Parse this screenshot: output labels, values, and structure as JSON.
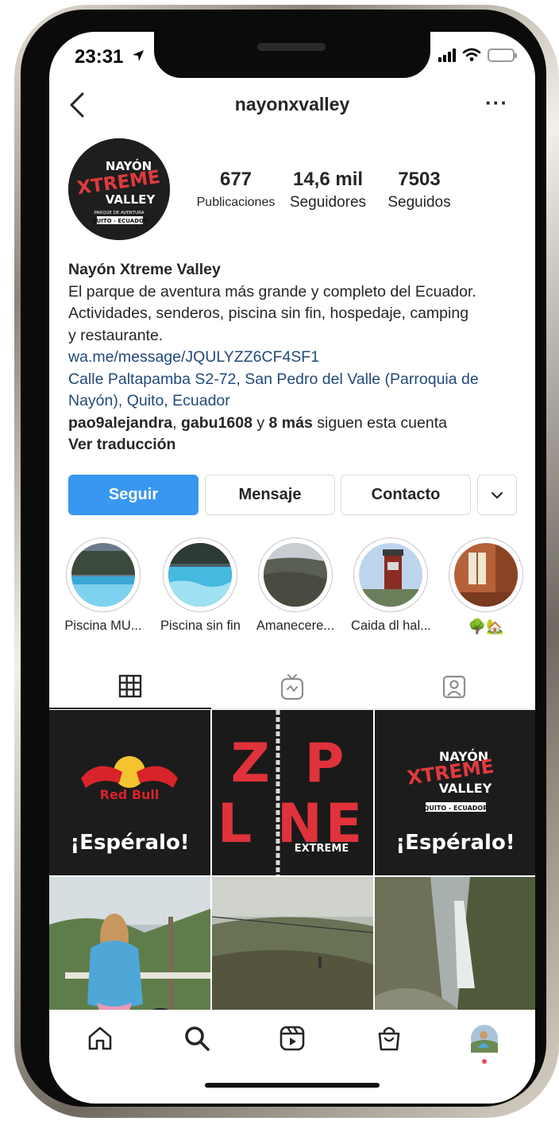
{
  "status": {
    "time": "23:31"
  },
  "header": {
    "username": "nayonxvalley",
    "more_label": "···"
  },
  "profile": {
    "logo": {
      "line1": "NAYÓN",
      "line2": "XTREME",
      "line3": "VALLEY",
      "sub": "PARQUE DE AVENTURA",
      "city": "QUITO - ECUADOR"
    },
    "stats": [
      {
        "value": "677",
        "label": "Publicaciones"
      },
      {
        "value": "14,6 mil",
        "label": "Seguidores"
      },
      {
        "value": "7503",
        "label": "Seguidos"
      }
    ],
    "name": "Nayón Xtreme Valley",
    "bio_line1": "El parque de aventura más grande y completo del Ecuador.",
    "bio_line2": "Actividades, senderos, piscina sin fin, hospedaje, camping",
    "bio_line3": "y restaurante.",
    "link": "wa.me/message/JQULYZZ6CF4SF1",
    "address_line1": "Calle Paltapamba S2-72, San Pedro del Valle (Parroquia de",
    "address_line2": "Nayón), Quito, Ecuador",
    "followed_by": {
      "user1": "pao9alejandra",
      "sep": ", ",
      "user2": "gabu1608",
      "and": " y ",
      "more": "8 más",
      "suffix": " siguen esta cuenta"
    },
    "translate": "Ver traducción"
  },
  "actions": {
    "follow": "Seguir",
    "message": "Mensaje",
    "contact": "Contacto",
    "dropdown": "⌄"
  },
  "highlights": [
    {
      "label": "Piscina MU..."
    },
    {
      "label": "Piscina sin fin"
    },
    {
      "label": "Amanecere..."
    },
    {
      "label": "Caida dl hal..."
    },
    {
      "label": "🌳🏡"
    }
  ],
  "posts": {
    "redbull_text": "Red Bull",
    "esperalo": "¡Espéralo!",
    "zipline_top": "Z P",
    "zipline_bottom": "L NE",
    "zipline_sub": "EXTREME"
  },
  "colors": {
    "accent": "#3897f0",
    "link": "#234a7a",
    "notification": "#ed4956"
  }
}
